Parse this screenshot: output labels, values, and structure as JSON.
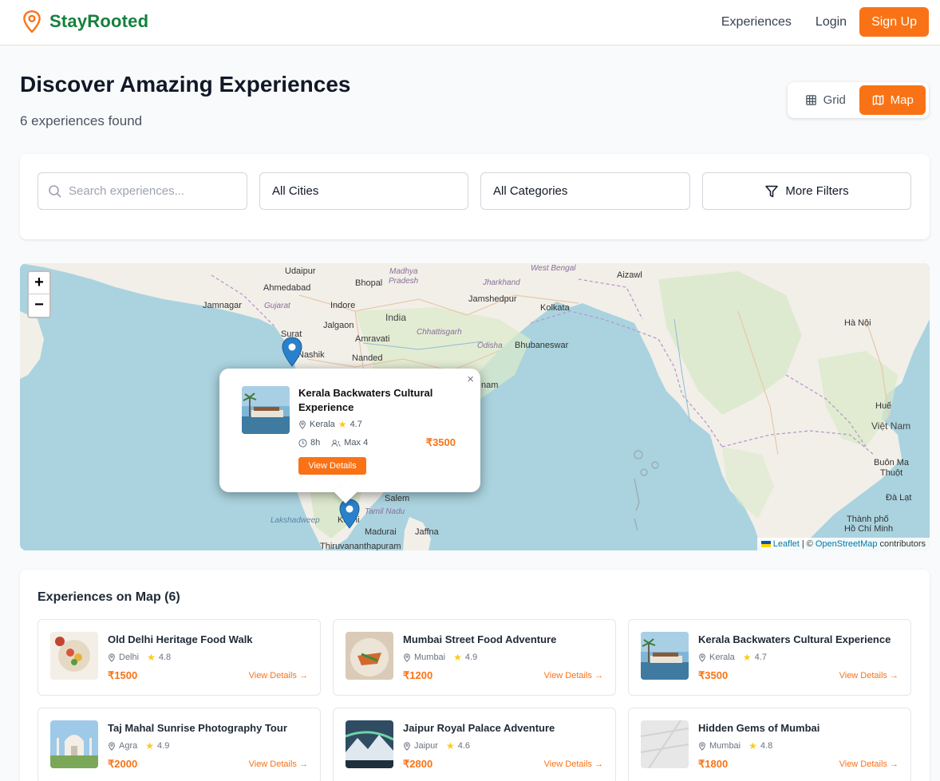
{
  "header": {
    "brand": "StayRooted",
    "nav": {
      "experiences": "Experiences",
      "login": "Login",
      "signup": "Sign Up"
    }
  },
  "page": {
    "title": "Discover Amazing Experiences",
    "subtitle": "6 experiences found",
    "view_toggle": {
      "grid": "Grid",
      "map": "Map",
      "active": "map"
    }
  },
  "filters": {
    "search_placeholder": "Search experiences...",
    "city": "All Cities",
    "category": "All Categories",
    "more": "More Filters"
  },
  "map": {
    "zoom_in": "+",
    "zoom_out": "−",
    "labels": {
      "udaipur": "Udaipur",
      "ahmedabad": "Ahmedabad",
      "jamnagar": "Jamnagar",
      "gujarat": "Gujarat",
      "bhopal": "Bhopal",
      "madhya": "Madhya",
      "pradesh": "Pradesh",
      "indore": "Indore",
      "india": "India",
      "surat": "Surat",
      "nashik": "Nashik",
      "jalgaon": "Jalgaon",
      "amravati": "Amravati",
      "nanded": "Nanded",
      "jharkhand": "Jharkhand",
      "westbengal": "West Bengal",
      "jamshedpur": "Jamshedpur",
      "kolkata": "Kolkata",
      "chhattisgarh": "Chhattisgarh",
      "odisha": "Odisha",
      "bhubaneswar": "Bhubaneswar",
      "nam": "nam",
      "kochi": "Kochi",
      "tamilnadu": "Tamil Nadu",
      "madurai": "Madurai",
      "salem": "Salem",
      "jaffna": "Jaffna",
      "lakshadweep": "Lakshadweep",
      "thiruvananthapuram": "Thiruvananthapuram",
      "aizawl": "Aizawl",
      "hanoi": "Hà Nội",
      "hue": "Huế",
      "vietnam": "Việt Nam",
      "buonmathuot1": "Buôn Ma",
      "buonmathuot2": "Thuột",
      "dalat": "Đà Lạt",
      "hcm1": "Thành phố",
      "hcm2": "Hồ Chí Minh"
    },
    "attribution": {
      "leaflet": "Leaflet",
      "sep": "| ©",
      "osm": "OpenStreetMap",
      "contrib": "contributors"
    },
    "popup": {
      "title": "Kerala Backwaters Cultural Experience",
      "location": "Kerala",
      "rating": "4.7",
      "duration": "8h",
      "group": "Max 4",
      "price": "₹3500",
      "button": "View Details",
      "close": "×"
    }
  },
  "list": {
    "title": "Experiences on Map (6)",
    "link_label": "View Details →",
    "items": [
      {
        "title": "Old Delhi Heritage Food Walk",
        "location": "Delhi",
        "rating": "4.8",
        "price": "₹1500"
      },
      {
        "title": "Mumbai Street Food Adventure",
        "location": "Mumbai",
        "rating": "4.9",
        "price": "₹1200"
      },
      {
        "title": "Kerala Backwaters Cultural Experience",
        "location": "Kerala",
        "rating": "4.7",
        "price": "₹3500"
      },
      {
        "title": "Taj Mahal Sunrise Photography Tour",
        "location": "Agra",
        "rating": "4.9",
        "price": "₹2000"
      },
      {
        "title": "Jaipur Royal Palace Adventure",
        "location": "Jaipur",
        "rating": "4.6",
        "price": "₹2800"
      },
      {
        "title": "Hidden Gems of Mumbai",
        "location": "Mumbai",
        "rating": "4.8",
        "price": "₹1800"
      }
    ]
  },
  "colors": {
    "brand": "#15803d",
    "accent": "#f97316",
    "map_water": "#aad3df",
    "map_land": "#f2efe9"
  }
}
